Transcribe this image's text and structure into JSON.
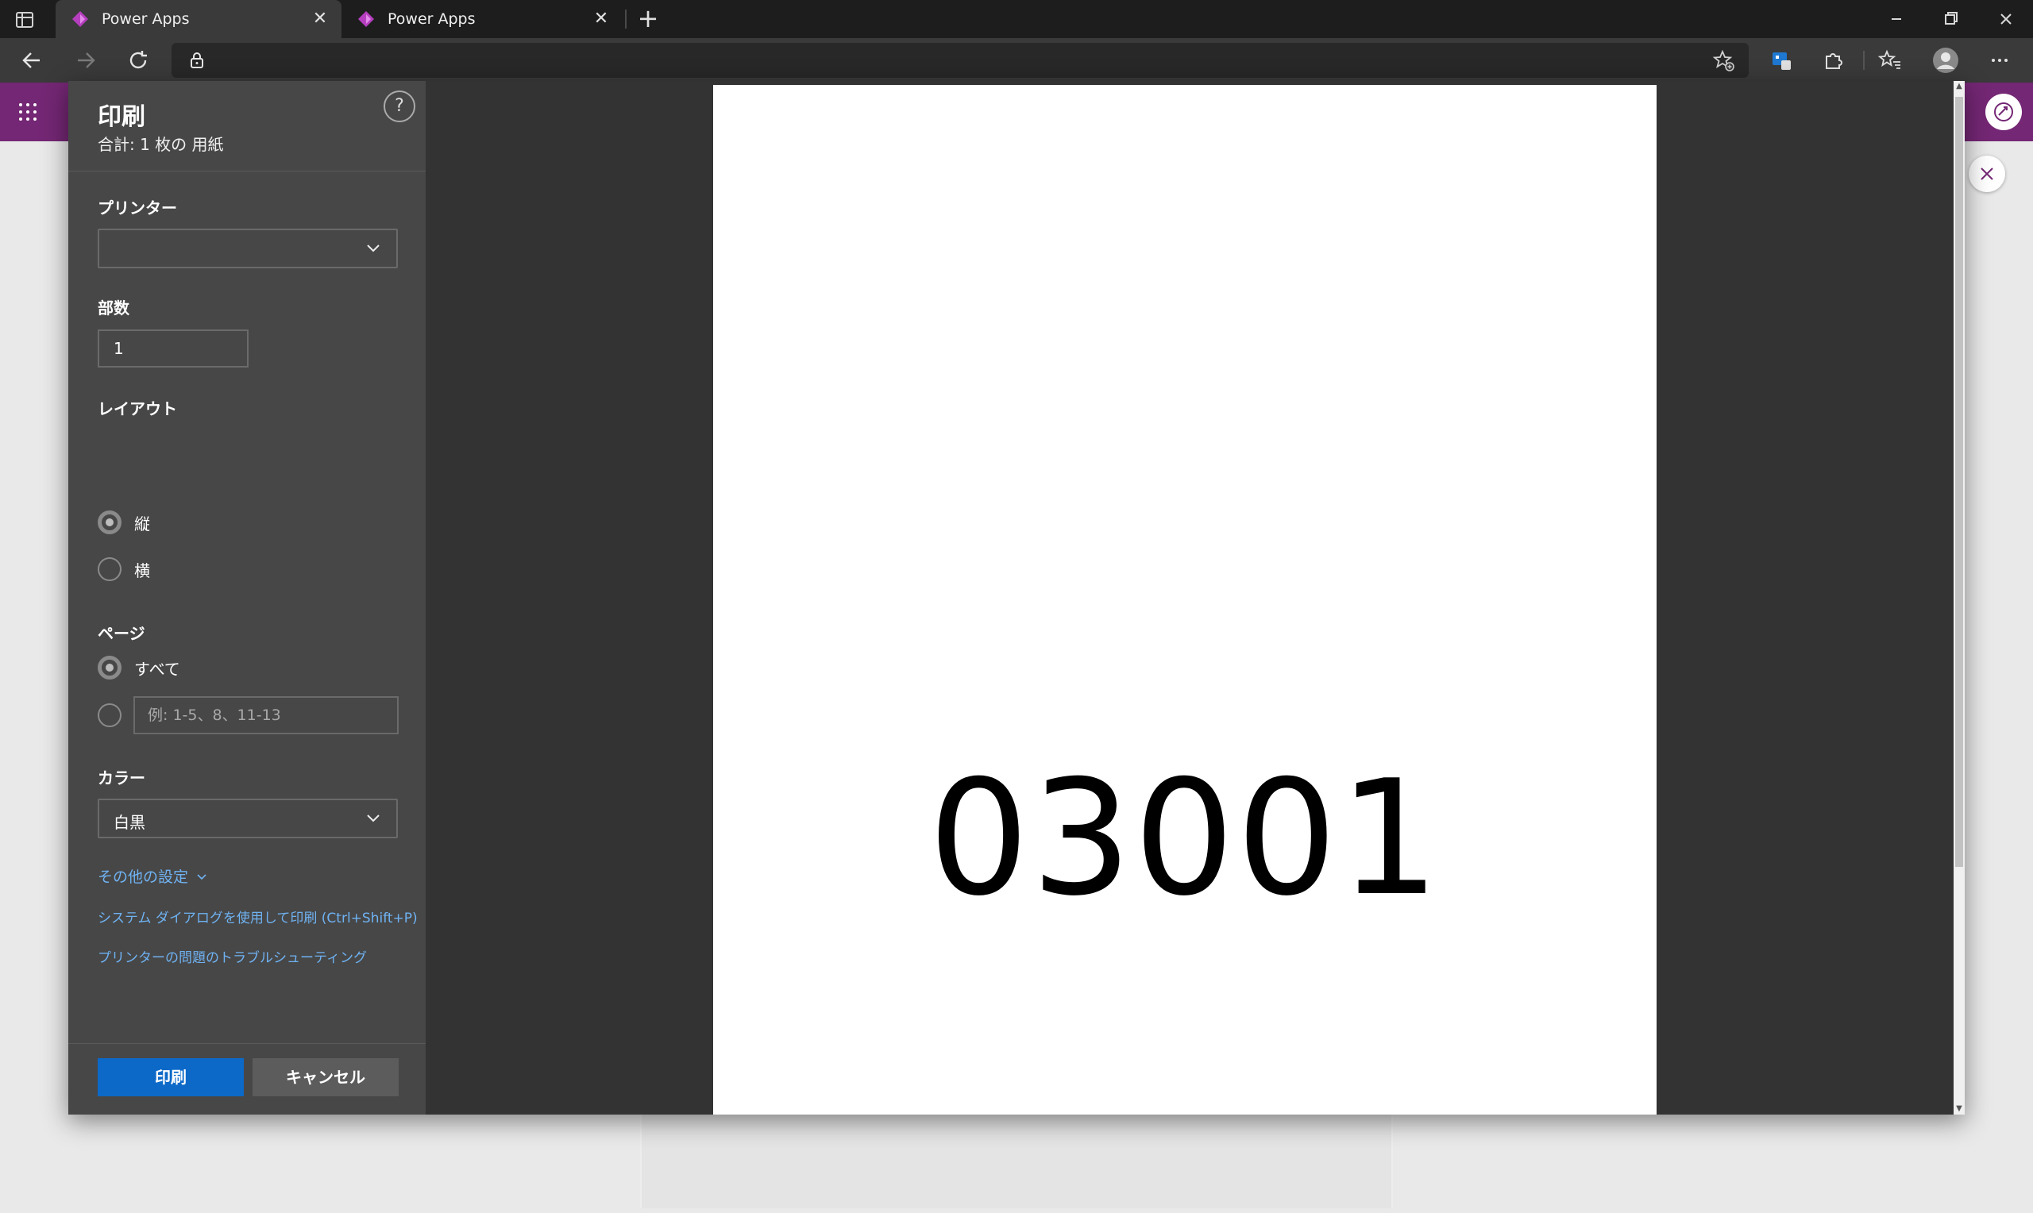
{
  "browser": {
    "tabs": [
      {
        "title": "Power Apps",
        "active": true
      },
      {
        "title": "Power Apps",
        "active": false
      }
    ],
    "address_url": ""
  },
  "print": {
    "title": "印刷",
    "total": "合計: 1 枚の 用紙",
    "help_glyph": "?",
    "printer_label": "プリンター",
    "printer_value": "",
    "copies_label": "部数",
    "copies_value": "1",
    "layout_label": "レイアウト",
    "layout_portrait": "縦",
    "layout_landscape": "横",
    "layout_selected": "縦",
    "pages_label": "ページ",
    "pages_all": "すべて",
    "pages_custom_placeholder": "例: 1-5、8、11-13",
    "pages_selected": "すべて",
    "color_label": "カラー",
    "color_value": "白黒",
    "more_settings": "その他の設定",
    "system_dialog_link": "システム ダイアログを使用して印刷 (Ctrl+Shift+P)",
    "troubleshoot_link": "プリンターの問題のトラブルシューティング",
    "print_button": "印刷",
    "cancel_button": "キャンセル"
  },
  "preview": {
    "page_text": "03001"
  },
  "colors": {
    "app_header": "#742774",
    "print_button": "#0c69c8",
    "link": "#6fb2f2"
  }
}
